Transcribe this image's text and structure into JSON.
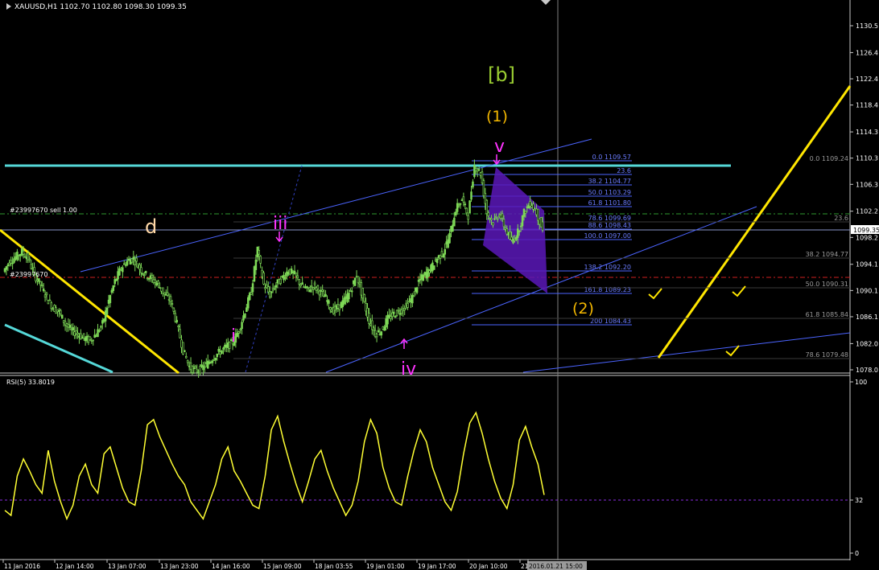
{
  "header": {
    "symbol_line": "XAUUSD,H1  1102.70 1102.80 1098.30 1099.35"
  },
  "price_axis": {
    "ticks": [
      "1130.5",
      "1126.4",
      "1122.4",
      "1118.4",
      "1114.3",
      "1110.3",
      "1106.3",
      "1102.2",
      "1098.2",
      "1094.1",
      "1090.1",
      "1086.1",
      "1082.0",
      "1078.0"
    ],
    "current_price": "1099.35"
  },
  "rsi_axis": {
    "ticks": [
      "100",
      "32",
      "0"
    ]
  },
  "time_axis": {
    "ticks": [
      "11 Jan 2016",
      "12 Jan 14:00",
      "13 Jan 07:00",
      "13 Jan 23:00",
      "14 Jan 16:00",
      "15 Jan 09:00",
      "18 Jan 03:55",
      "19 Jan 01:00",
      "19 Jan 17:00",
      "20 Jan 10:00",
      "21",
      "2016.01.21 15:00"
    ]
  },
  "orders": {
    "sell_label": "#23997670 sell 1.00",
    "sl_label": "#23997670"
  },
  "fib_left": [
    {
      "label": "0.0 1109.57"
    },
    {
      "label": "23.6"
    },
    {
      "label": "38.2 1104.77"
    },
    {
      "label": "50.0 1103.29"
    },
    {
      "label": "61.8 1101.80"
    },
    {
      "label": "78.6 1099.69"
    },
    {
      "label": "88.6 1098.43"
    },
    {
      "label": "100.0 1097.00"
    },
    {
      "label": "138.2 1092.20"
    },
    {
      "label": "161.8 1089.23"
    },
    {
      "label": "200 1084.43"
    }
  ],
  "fib_right": [
    {
      "label": "0.0 1109.24"
    },
    {
      "label": "23.6"
    },
    {
      "label": "38.2 1094.77"
    },
    {
      "label": "50.0 1090.31"
    },
    {
      "label": "61.8 1085.84"
    },
    {
      "label": "78.6 1079.48"
    }
  ],
  "wave_labels": {
    "b": "[b]",
    "one": "(1)",
    "v": "v",
    "two": "(2)",
    "d": "d",
    "iii": "iii",
    "i": "i",
    "iv": "iv"
  },
  "rsi": {
    "label": "RSI(5) 33.8019"
  },
  "colors": {
    "background": "#000000",
    "candle": "#7ed957",
    "rsi_line": "#ffff33",
    "fib": "#4b64ff",
    "cyan": "#55d8d8",
    "yellow": "#ffe600",
    "magenta": "#ff33ff",
    "olive": "#9acd32",
    "orange": "#f5b800",
    "peach": "#ffd8a8"
  },
  "chart_data": {
    "type": "candlestick",
    "symbol": "XAUUSD",
    "timeframe": "H1",
    "y_range": [
      1078.0,
      1130.5
    ],
    "price_path": [
      1093.0,
      1094.5,
      1095.2,
      1096.0,
      1095.0,
      1092.5,
      1091.0,
      1089.0,
      1087.5,
      1086.8,
      1085.0,
      1084.0,
      1083.5,
      1082.8,
      1082.5,
      1083.5,
      1085.0,
      1088.5,
      1091.5,
      1093.5,
      1094.6,
      1095.0,
      1093.5,
      1092.5,
      1091.8,
      1091.0,
      1089.5,
      1088.5,
      1085.0,
      1081.0,
      1078.5,
      1077.8,
      1078.2,
      1079.0,
      1080.0,
      1080.8,
      1081.5,
      1082.2,
      1084.0,
      1087.0,
      1090.0,
      1096.5,
      1091.0,
      1089.5,
      1091.0,
      1092.0,
      1093.2,
      1092.5,
      1091.0,
      1090.2,
      1090.8,
      1090.0,
      1089.0,
      1087.0,
      1087.5,
      1088.5,
      1090.0,
      1092.5,
      1089.0,
      1085.5,
      1083.5,
      1084.0,
      1085.8,
      1086.5,
      1087.0,
      1087.8,
      1089.0,
      1091.5,
      1092.5,
      1093.5,
      1095.0,
      1096.0,
      1098.5,
      1102.5,
      1104.0,
      1101.5,
      1109.2,
      1108.0,
      1102.0,
      1100.5,
      1101.8,
      1099.5,
      1097.5,
      1099.0,
      1102.0,
      1103.5,
      1102.0,
      1099.35
    ],
    "rsi_series": [
      25,
      22,
      45,
      55,
      48,
      40,
      35,
      60,
      42,
      30,
      20,
      28,
      45,
      52,
      40,
      35,
      58,
      62,
      50,
      38,
      30,
      28,
      48,
      75,
      78,
      68,
      60,
      52,
      45,
      40,
      30,
      25,
      20,
      30,
      40,
      55,
      62,
      48,
      42,
      35,
      28,
      26,
      45,
      72,
      80,
      65,
      52,
      40,
      30,
      42,
      55,
      60,
      48,
      38,
      30,
      22,
      28,
      42,
      65,
      78,
      70,
      50,
      38,
      30,
      28,
      45,
      60,
      72,
      65,
      50,
      40,
      30,
      25,
      36,
      58,
      76,
      82,
      70,
      55,
      42,
      32,
      26,
      40,
      66,
      74,
      62,
      52,
      34
    ],
    "rsi_levels": [
      32,
      100,
      0
    ],
    "horizontal_levels": [
      1109.24,
      1101.3,
      1092.5
    ],
    "fib_retracement_recent": {
      "0.0": 1109.57,
      "38.2": 1104.77,
      "50.0": 1103.29,
      "61.8": 1101.8,
      "78.6": 1099.69,
      "88.6": 1098.43,
      "100.0": 1097.0,
      "138.2": 1092.2,
      "161.8": 1089.23,
      "200": 1084.43
    },
    "fib_retracement_wide": {
      "0.0": 1109.24,
      "38.2": 1094.77,
      "50.0": 1090.31,
      "61.8": 1085.84,
      "78.6": 1079.48
    }
  }
}
